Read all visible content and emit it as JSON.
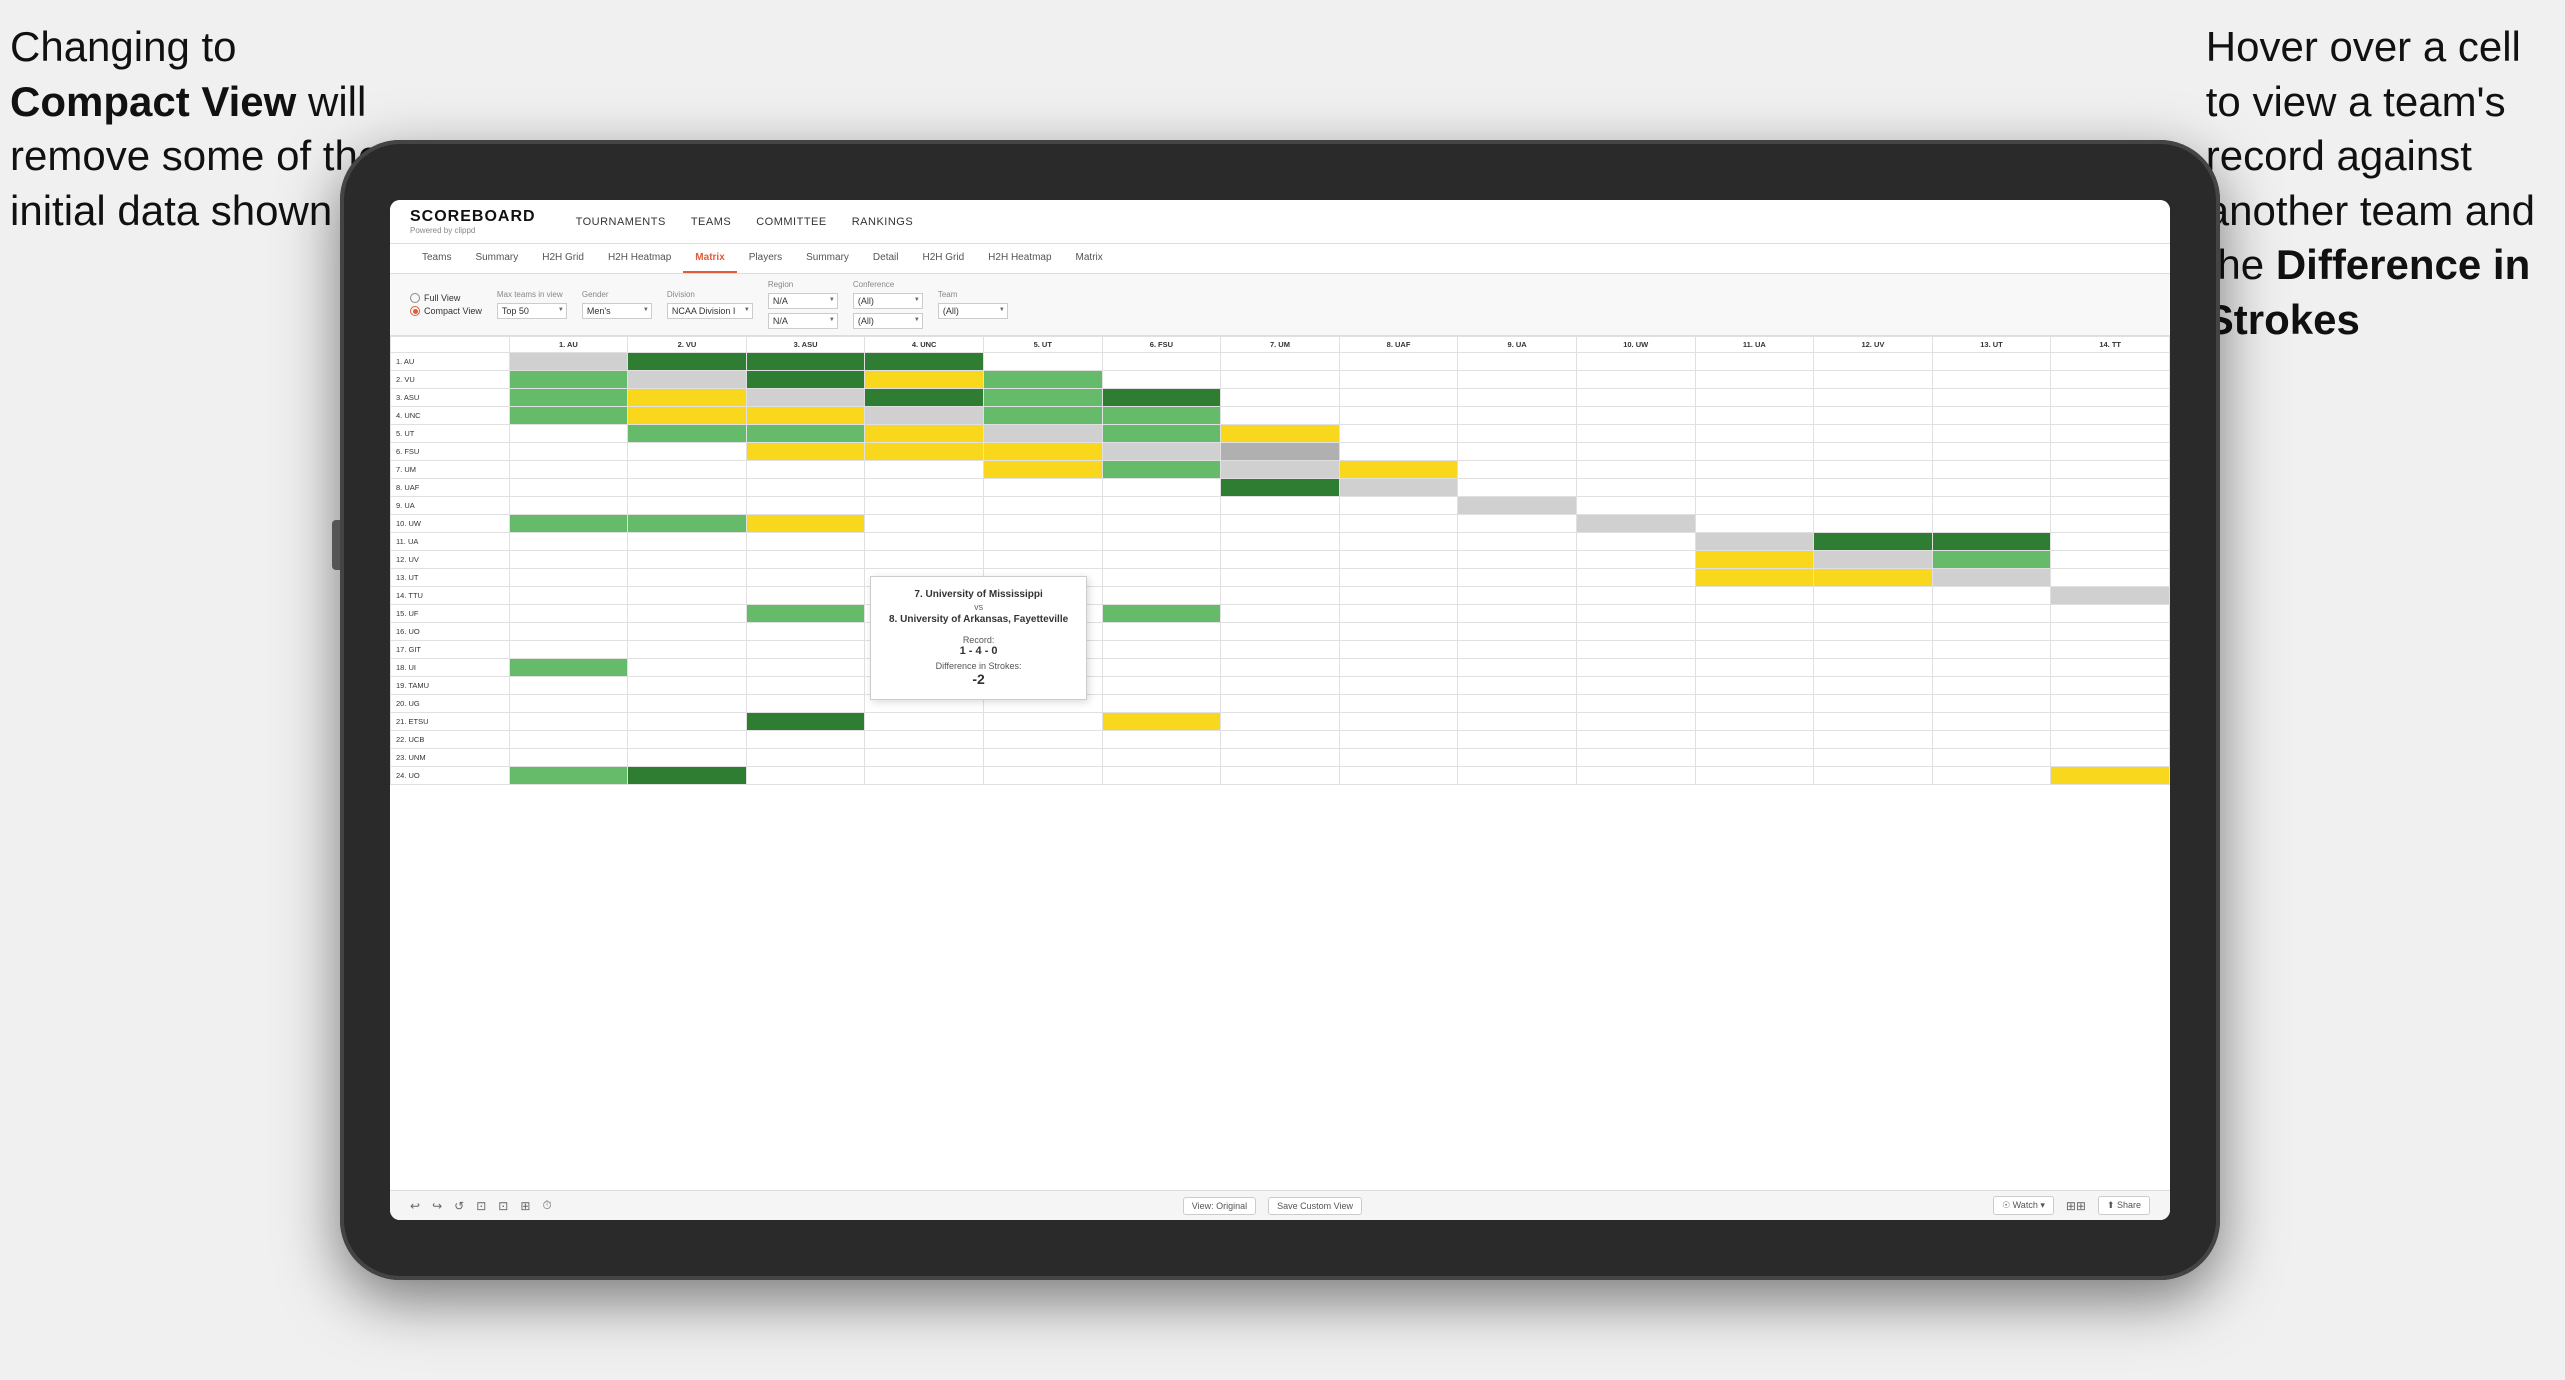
{
  "annotations": {
    "left": {
      "line1": "Changing to",
      "line2_bold": "Compact View",
      "line2_rest": " will",
      "line3": "remove some of the",
      "line4": "initial data shown"
    },
    "right": {
      "line1": "Hover over a cell",
      "line2": "to view a team's",
      "line3": "record against",
      "line4": "another team and",
      "line5_pre": "the ",
      "line5_bold": "Difference in",
      "line6_bold": "Strokes"
    }
  },
  "nav": {
    "logo": "SCOREBOARD",
    "logo_sub": "Powered by clippd",
    "links": [
      "TOURNAMENTS",
      "TEAMS",
      "COMMITTEE",
      "RANKINGS"
    ]
  },
  "sub_nav": {
    "tabs": [
      {
        "label": "Teams",
        "active": false
      },
      {
        "label": "Summary",
        "active": false
      },
      {
        "label": "H2H Grid",
        "active": false
      },
      {
        "label": "H2H Heatmap",
        "active": false
      },
      {
        "label": "Matrix",
        "active": true
      },
      {
        "label": "Players",
        "active": false
      },
      {
        "label": "Summary",
        "active": false
      },
      {
        "label": "Detail",
        "active": false
      },
      {
        "label": "H2H Grid",
        "active": false
      },
      {
        "label": "H2H Heatmap",
        "active": false
      },
      {
        "label": "Matrix",
        "active": false
      }
    ]
  },
  "filters": {
    "view_options": [
      "Full View",
      "Compact View"
    ],
    "selected_view": "Compact View",
    "max_teams_label": "Max teams in view",
    "max_teams_value": "Top 50",
    "gender_label": "Gender",
    "gender_value": "Men's",
    "division_label": "Division",
    "division_value": "NCAA Division I",
    "region_label": "Region",
    "region_values": [
      "N/A",
      "N/A"
    ],
    "conference_label": "Conference",
    "conference_values": [
      "(All)",
      "(All)"
    ],
    "team_label": "Team",
    "team_values": [
      "(All)"
    ]
  },
  "matrix": {
    "col_headers": [
      "1. AU",
      "2. VU",
      "3. ASU",
      "4. UNC",
      "5. UT",
      "6. FSU",
      "7. UM",
      "8. UAF",
      "9. UA",
      "10. UW",
      "11. UA",
      "12. UV",
      "13. UT",
      "14. TT"
    ],
    "rows": [
      {
        "label": "1. AU",
        "cells": [
          "diag",
          "green-dark",
          "green-dark",
          "green-dark",
          "white",
          "white",
          "white",
          "white",
          "white",
          "white",
          "white",
          "white",
          "white",
          "white"
        ]
      },
      {
        "label": "2. VU",
        "cells": [
          "green-light",
          "diag",
          "green-dark",
          "yellow",
          "green-light",
          "white",
          "white",
          "white",
          "white",
          "white",
          "white",
          "white",
          "white",
          "white"
        ]
      },
      {
        "label": "3. ASU",
        "cells": [
          "green-light",
          "yellow",
          "diag",
          "green-dark",
          "green-light",
          "green-dark",
          "white",
          "white",
          "white",
          "white",
          "white",
          "white",
          "white",
          "white"
        ]
      },
      {
        "label": "4. UNC",
        "cells": [
          "green-light",
          "yellow",
          "yellow",
          "diag",
          "green-light",
          "green-light",
          "white",
          "white",
          "white",
          "white",
          "white",
          "white",
          "white",
          "white"
        ]
      },
      {
        "label": "5. UT",
        "cells": [
          "white",
          "green-light",
          "green-light",
          "yellow",
          "diag",
          "green-light",
          "yellow",
          "white",
          "white",
          "white",
          "white",
          "white",
          "white",
          "white"
        ]
      },
      {
        "label": "6. FSU",
        "cells": [
          "white",
          "white",
          "yellow",
          "yellow",
          "yellow",
          "diag",
          "gray",
          "white",
          "white",
          "white",
          "white",
          "white",
          "white",
          "white"
        ]
      },
      {
        "label": "7. UM",
        "cells": [
          "white",
          "white",
          "white",
          "white",
          "yellow",
          "green-light",
          "diag",
          "yellow",
          "white",
          "white",
          "white",
          "white",
          "white",
          "white"
        ]
      },
      {
        "label": "8. UAF",
        "cells": [
          "white",
          "white",
          "white",
          "white",
          "white",
          "white",
          "green-dark",
          "diag",
          "white",
          "white",
          "white",
          "white",
          "white",
          "white"
        ]
      },
      {
        "label": "9. UA",
        "cells": [
          "white",
          "white",
          "white",
          "white",
          "white",
          "white",
          "white",
          "white",
          "diag",
          "white",
          "white",
          "white",
          "white",
          "white"
        ]
      },
      {
        "label": "10. UW",
        "cells": [
          "green-light",
          "green-light",
          "yellow",
          "white",
          "white",
          "white",
          "white",
          "white",
          "white",
          "diag",
          "white",
          "white",
          "white",
          "white"
        ]
      },
      {
        "label": "11. UA",
        "cells": [
          "white",
          "white",
          "white",
          "white",
          "white",
          "white",
          "white",
          "white",
          "white",
          "white",
          "diag",
          "green-dark",
          "green-dark",
          "white"
        ]
      },
      {
        "label": "12. UV",
        "cells": [
          "white",
          "white",
          "white",
          "white",
          "white",
          "white",
          "white",
          "white",
          "white",
          "white",
          "yellow",
          "diag",
          "green-light",
          "white"
        ]
      },
      {
        "label": "13. UT",
        "cells": [
          "white",
          "white",
          "white",
          "white",
          "white",
          "white",
          "white",
          "white",
          "white",
          "white",
          "yellow",
          "yellow",
          "diag",
          "white"
        ]
      },
      {
        "label": "14. TTU",
        "cells": [
          "white",
          "white",
          "white",
          "white",
          "white",
          "white",
          "white",
          "white",
          "white",
          "white",
          "white",
          "white",
          "white",
          "diag"
        ]
      },
      {
        "label": "15. UF",
        "cells": [
          "white",
          "white",
          "green-light",
          "white",
          "white",
          "green-light",
          "white",
          "white",
          "white",
          "white",
          "white",
          "white",
          "white",
          "white"
        ]
      },
      {
        "label": "16. UO",
        "cells": [
          "white",
          "white",
          "white",
          "white",
          "white",
          "white",
          "white",
          "white",
          "white",
          "white",
          "white",
          "white",
          "white",
          "white"
        ]
      },
      {
        "label": "17. GIT",
        "cells": [
          "white",
          "white",
          "white",
          "white",
          "white",
          "white",
          "white",
          "white",
          "white",
          "white",
          "white",
          "white",
          "white",
          "white"
        ]
      },
      {
        "label": "18. UI",
        "cells": [
          "green-light",
          "white",
          "white",
          "white",
          "white",
          "white",
          "white",
          "white",
          "white",
          "white",
          "white",
          "white",
          "white",
          "white"
        ]
      },
      {
        "label": "19. TAMU",
        "cells": [
          "white",
          "white",
          "white",
          "white",
          "white",
          "white",
          "white",
          "white",
          "white",
          "white",
          "white",
          "white",
          "white",
          "white"
        ]
      },
      {
        "label": "20. UG",
        "cells": [
          "white",
          "white",
          "white",
          "white",
          "white",
          "white",
          "white",
          "white",
          "white",
          "white",
          "white",
          "white",
          "white",
          "white"
        ]
      },
      {
        "label": "21. ETSU",
        "cells": [
          "white",
          "white",
          "green-dark",
          "white",
          "white",
          "yellow",
          "white",
          "white",
          "white",
          "white",
          "white",
          "white",
          "white",
          "white"
        ]
      },
      {
        "label": "22. UCB",
        "cells": [
          "white",
          "white",
          "white",
          "white",
          "white",
          "white",
          "white",
          "white",
          "white",
          "white",
          "white",
          "white",
          "white",
          "white"
        ]
      },
      {
        "label": "23. UNM",
        "cells": [
          "white",
          "white",
          "white",
          "white",
          "white",
          "white",
          "white",
          "white",
          "white",
          "white",
          "white",
          "white",
          "white",
          "white"
        ]
      },
      {
        "label": "24. UO",
        "cells": [
          "green-light",
          "green-dark",
          "white",
          "white",
          "white",
          "white",
          "white",
          "white",
          "white",
          "white",
          "white",
          "white",
          "white",
          "yellow"
        ]
      }
    ]
  },
  "tooltip": {
    "team1_rank": "7.",
    "team1_name": "University of Mississippi",
    "vs": "vs",
    "team2_rank": "8.",
    "team2_name": "University of Arkansas, Fayetteville",
    "record_label": "Record:",
    "record_value": "1 - 4 - 0",
    "strokes_label": "Difference in Strokes:",
    "strokes_value": "-2"
  },
  "bottom_toolbar": {
    "buttons": [
      "View: Original",
      "Save Custom View"
    ],
    "icons": [
      "↩",
      "↪",
      "↺",
      "⊡",
      "⊡",
      "⊞",
      "⏱"
    ],
    "right_buttons": [
      "Watch ▾",
      "☐ ☐",
      "Share"
    ]
  }
}
